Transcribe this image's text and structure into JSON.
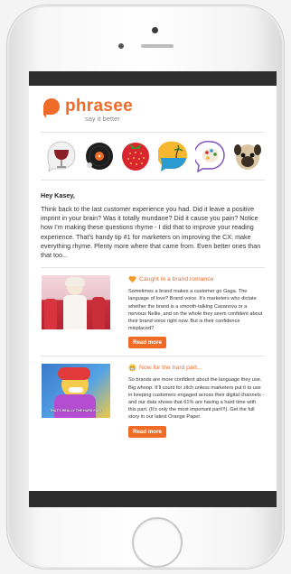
{
  "brand": {
    "name": "phrasee",
    "tagline": "say it better",
    "color": "#ef6b2a"
  },
  "icons": [
    "wine-glass-icon",
    "vinyl-record-icon",
    "strawberry-icon",
    "sun-beach-icon",
    "palette-icon",
    "pug-icon"
  ],
  "email": {
    "greeting": "Hey Kasey,",
    "intro": "Think back to the last customer experience you had. Did it leave a positive imprint in your brain? Was it totally mundane? Did it cause you pain? Notice how I’m making these questions rhyme - I did that to improve your reading experience. That’s handy tip #1 for marketers on improving the CX: make everything rhyme. Plenty more where that came from. Even better ones than that too...",
    "articles": [
      {
        "title": "Caught in a brand romance",
        "emoji": "orange-heart-icon",
        "text": "Sometimes a brand makes a customer go Gaga. The language of love? Brand voice. It’s marketers who dictate whether the brand is a smooth-talking Casanova or a nervous Nellie, and on the whole they seem confident about their brand voice right now. But is their confidence misplaced?",
        "button": "Read more"
      },
      {
        "title": "Now for the hard part...",
        "emoji": "grimacing-face-icon",
        "text": "So brands are more confident about the language they use. Big whoop. It’ll count for zilch unless marketers put it to use in keeping customers engaged across their digital channels - and our data shows that 61% are having a hard time with this part. (It’s only the most important part!!!). Get the full story in our latest Orange Paper.",
        "button": "Read more",
        "image_caption": "THAT’S REALLY THE HARD PART"
      }
    ]
  },
  "colors": {
    "accent": "#f06c26",
    "bar": "#2e2e2e"
  }
}
